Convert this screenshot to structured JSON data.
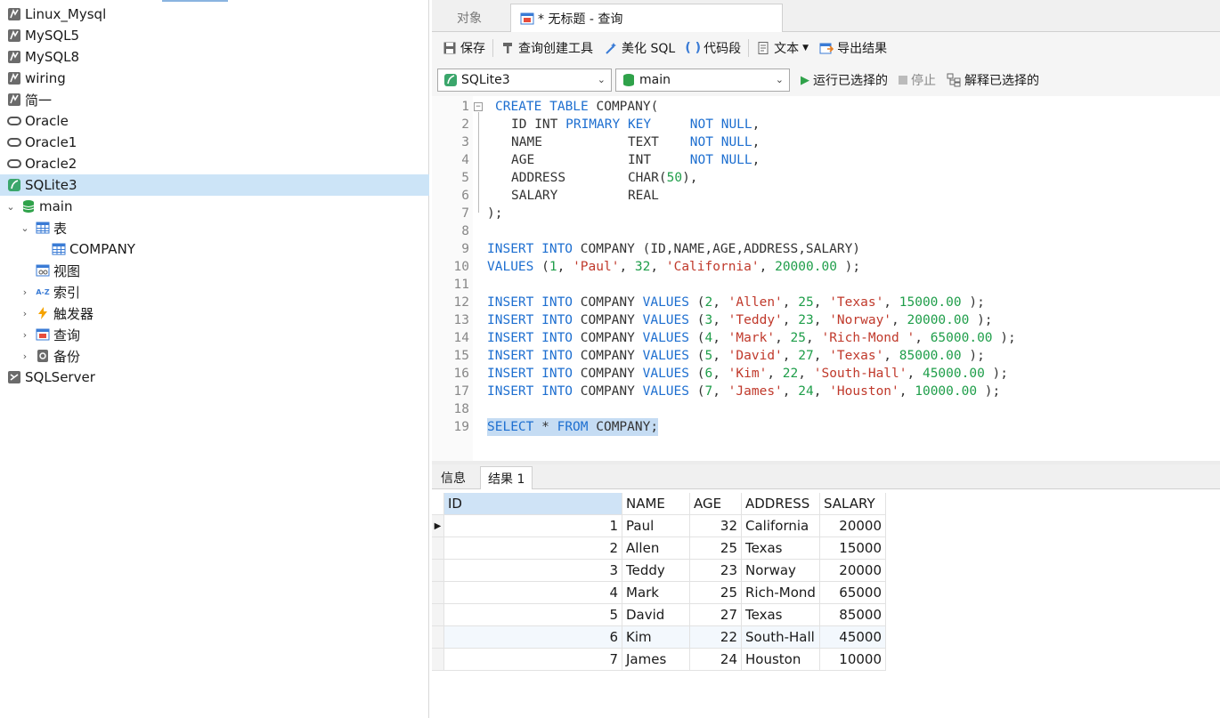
{
  "sidebar": {
    "connections": [
      {
        "label": "Linux_Mysql",
        "icon": "mysql-icon"
      },
      {
        "label": "MySQL5",
        "icon": "mysql-icon"
      },
      {
        "label": "MySQL8",
        "icon": "mysql-icon"
      },
      {
        "label": "wiring",
        "icon": "mysql-icon"
      },
      {
        "label": "简一",
        "icon": "mysql-icon"
      },
      {
        "label": "Oracle",
        "icon": "oracle-icon"
      },
      {
        "label": "Oracle1",
        "icon": "oracle-icon"
      },
      {
        "label": "Oracle2",
        "icon": "oracle-icon"
      },
      {
        "label": "SQLite3",
        "icon": "sqlite-icon"
      }
    ],
    "database": {
      "label": "main"
    },
    "tables_group": {
      "label": "表"
    },
    "table": {
      "label": "COMPANY"
    },
    "views": {
      "label": "视图"
    },
    "indexes": {
      "label": "索引"
    },
    "triggers": {
      "label": "触发器"
    },
    "queries": {
      "label": "查询"
    },
    "backups": {
      "label": "备份"
    },
    "sqlserver": {
      "label": "SQLServer"
    }
  },
  "tabs": {
    "objects": "对象",
    "query": "* 无标题 - 查询"
  },
  "toolbar": {
    "save": "保存",
    "query_builder": "查询创建工具",
    "beautify": "美化 SQL",
    "snippet": "代码段",
    "text": "文本",
    "export": "导出结果"
  },
  "toolbar2": {
    "connection": "SQLite3",
    "database": "main",
    "run": "运行已选择的",
    "stop": "停止",
    "explain": "解释已选择的"
  },
  "editor": {
    "line_numbers": [
      "1",
      "2",
      "3",
      "4",
      "5",
      "6",
      "7",
      "8",
      "9",
      "10",
      "11",
      "12",
      "13",
      "14",
      "15",
      "16",
      "17",
      "18",
      "19"
    ]
  },
  "result_tabs": {
    "info": "信息",
    "result1": "结果 1"
  },
  "result": {
    "columns": [
      "ID",
      "NAME",
      "AGE",
      "ADDRESS",
      "SALARY"
    ],
    "rows": [
      [
        "1",
        "Paul",
        "32",
        "California",
        "20000"
      ],
      [
        "2",
        "Allen",
        "25",
        "Texas",
        "15000"
      ],
      [
        "3",
        "Teddy",
        "23",
        "Norway",
        "20000"
      ],
      [
        "4",
        "Mark",
        "25",
        "Rich-Mond",
        "65000"
      ],
      [
        "5",
        "David",
        "27",
        "Texas",
        "85000"
      ],
      [
        "6",
        "Kim",
        "22",
        "South-Hall",
        "45000"
      ],
      [
        "7",
        "James",
        "24",
        "Houston",
        "10000"
      ]
    ]
  },
  "colors": {
    "keyword": "#1e6fd0",
    "string": "#c0392b",
    "number": "#1f9e4a",
    "selection": "#cce4f7"
  }
}
